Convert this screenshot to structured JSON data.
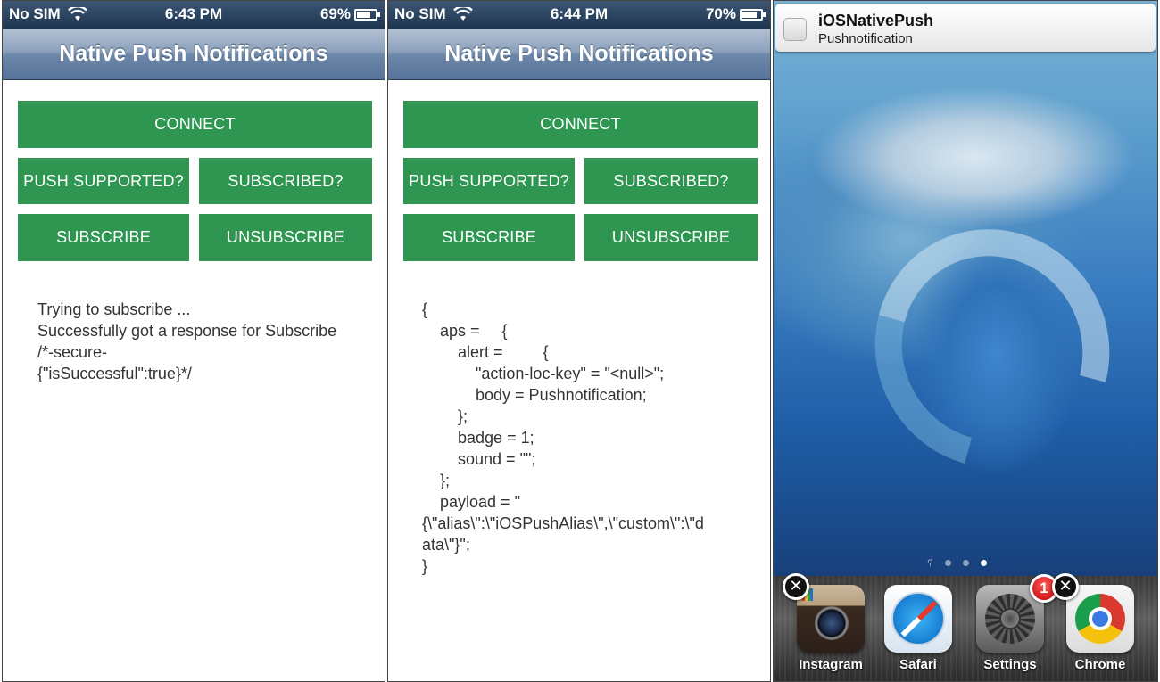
{
  "screens": [
    {
      "status": {
        "carrier": "No SIM",
        "time": "6:43 PM",
        "battery": "69%"
      },
      "nav_title": "Native Push Notifications",
      "buttons": {
        "connect": "CONNECT",
        "push_supported": "PUSH SUPPORTED?",
        "subscribed": "SUBSCRIBED?",
        "subscribe": "SUBSCRIBE",
        "unsubscribe": "UNSUBSCRIBE"
      },
      "log": [
        "Trying to subscribe ...",
        "Successfully got a response for Subscribe",
        "/*-secure-",
        "{\"isSuccessful\":true}*/"
      ]
    },
    {
      "status": {
        "carrier": "No SIM",
        "time": "6:44 PM",
        "battery": "70%"
      },
      "nav_title": "Native Push Notifications",
      "buttons": {
        "connect": "CONNECT",
        "push_supported": "PUSH SUPPORTED?",
        "subscribed": "SUBSCRIBED?",
        "subscribe": "SUBSCRIBE",
        "unsubscribe": "UNSUBSCRIBE"
      },
      "payload_lines": [
        "{",
        "    aps =     {",
        "        alert =         {",
        "            \"action-loc-key\" = \"<null>\";",
        "            body = Pushnotification;",
        "        };",
        "        badge = 1;",
        "        sound = \"\";",
        "    };",
        "    payload = \"",
        "{\\\"alias\\\":\\\"iOSPushAlias\\\",\\\"custom\\\":\\\"d",
        "ata\\\"}\";",
        "}"
      ]
    }
  ],
  "home": {
    "notification": {
      "title": "iOSNativePush",
      "body": "Pushnotification"
    },
    "dock": [
      {
        "label": "Instagram",
        "icon": "instagram-icon",
        "delete": true
      },
      {
        "label": "Safari",
        "icon": "safari-icon"
      },
      {
        "label": "Settings",
        "icon": "settings-icon",
        "badge": "1"
      },
      {
        "label": "Chrome",
        "icon": "chrome-icon",
        "delete": true
      }
    ],
    "page_dots": 3
  },
  "colors": {
    "button_green": "#2e9651",
    "navbar_blue": "#57739a"
  }
}
